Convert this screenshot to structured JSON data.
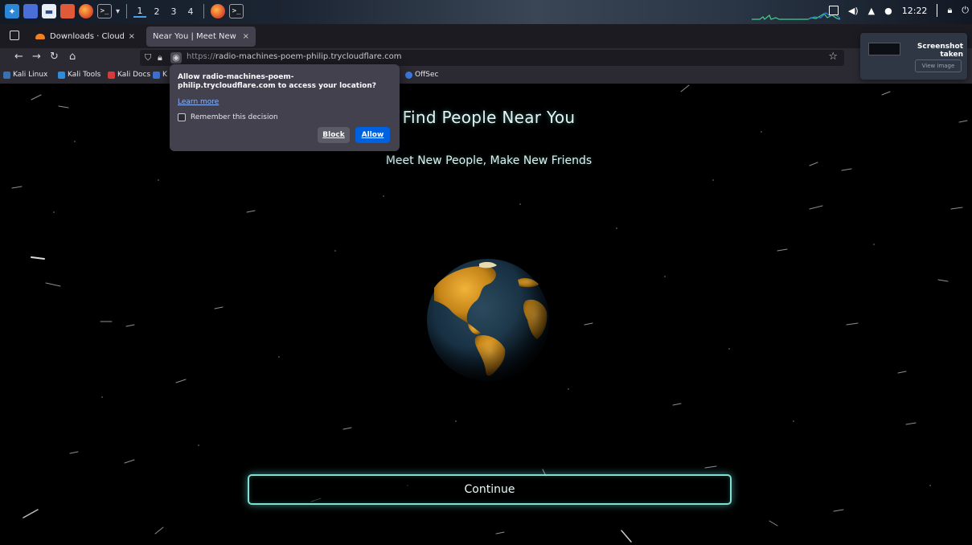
{
  "taskbar": {
    "workspaces": [
      "1",
      "2",
      "3",
      "4"
    ],
    "clock": "12:22",
    "colors": {
      "accent": "#4d9de0"
    }
  },
  "browser": {
    "tabs": [
      {
        "title": "Downloads · Cloudflare Z",
        "close": "×"
      },
      {
        "title": "Near You | Meet New Peo",
        "close": "×"
      }
    ],
    "new_tab": "+",
    "url": {
      "protocol": "https://",
      "host": "radio-machines-poem-philip.trycloudflare.com"
    },
    "bookmarks": [
      "Kali Linux",
      "Kali Tools",
      "Kali Docs",
      "K",
      "OffSec"
    ]
  },
  "permission_popup": {
    "question": "Allow radio-machines-poem-philip.trycloudflare.com to access your location?",
    "learn_more": "Learn more",
    "remember": "Remember this decision",
    "block": "Block",
    "allow": "Allow"
  },
  "page": {
    "title": "Find People Near You",
    "subtitle": "Meet New People, Make New Friends",
    "continue_label": "Continue",
    "colors": {
      "glow": "#7fe0d4"
    }
  },
  "notification": {
    "title": "Screenshot taken",
    "action": "View image"
  }
}
